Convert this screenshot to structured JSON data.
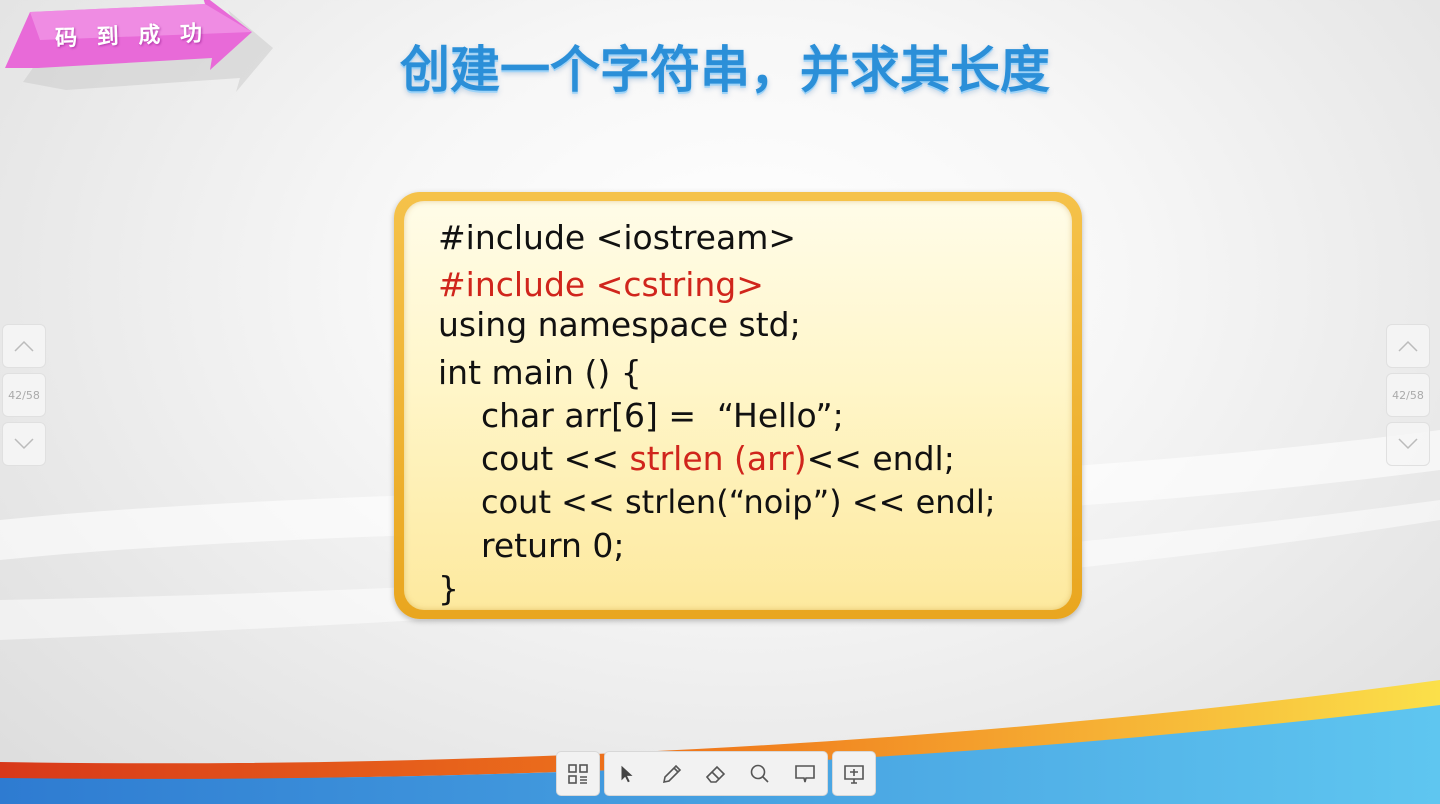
{
  "banner": {
    "text": "码 到 成 功"
  },
  "title": "创建一个字符串，并求其长度",
  "code": {
    "lines": [
      {
        "text": "#include <iostream>"
      },
      {
        "text": "#include <cstring>"
      },
      {
        "text": "using namespace std;"
      },
      {
        "text": "int main () {"
      },
      {
        "text": "char arr[6] =  “Hello”;"
      },
      {
        "prefix": "cout << ",
        "highlight": "strlen (arr)",
        "suffix": "<< endl;"
      },
      {
        "text": "cout << strlen(“noip”) << endl;"
      },
      {
        "text": "return 0;"
      },
      {
        "text": "}"
      }
    ]
  },
  "nav": {
    "page_indicator": "42/58"
  },
  "toolbar": {
    "icons": [
      "grid-menu-icon",
      "pointer-icon",
      "pen-icon",
      "eraser-icon",
      "search-icon",
      "comment-icon",
      "screen-icon"
    ]
  },
  "colors": {
    "title": "#2b8fd8",
    "highlight": "#d0251c",
    "banner": "#e86ad8",
    "frame": "#eeb030"
  }
}
